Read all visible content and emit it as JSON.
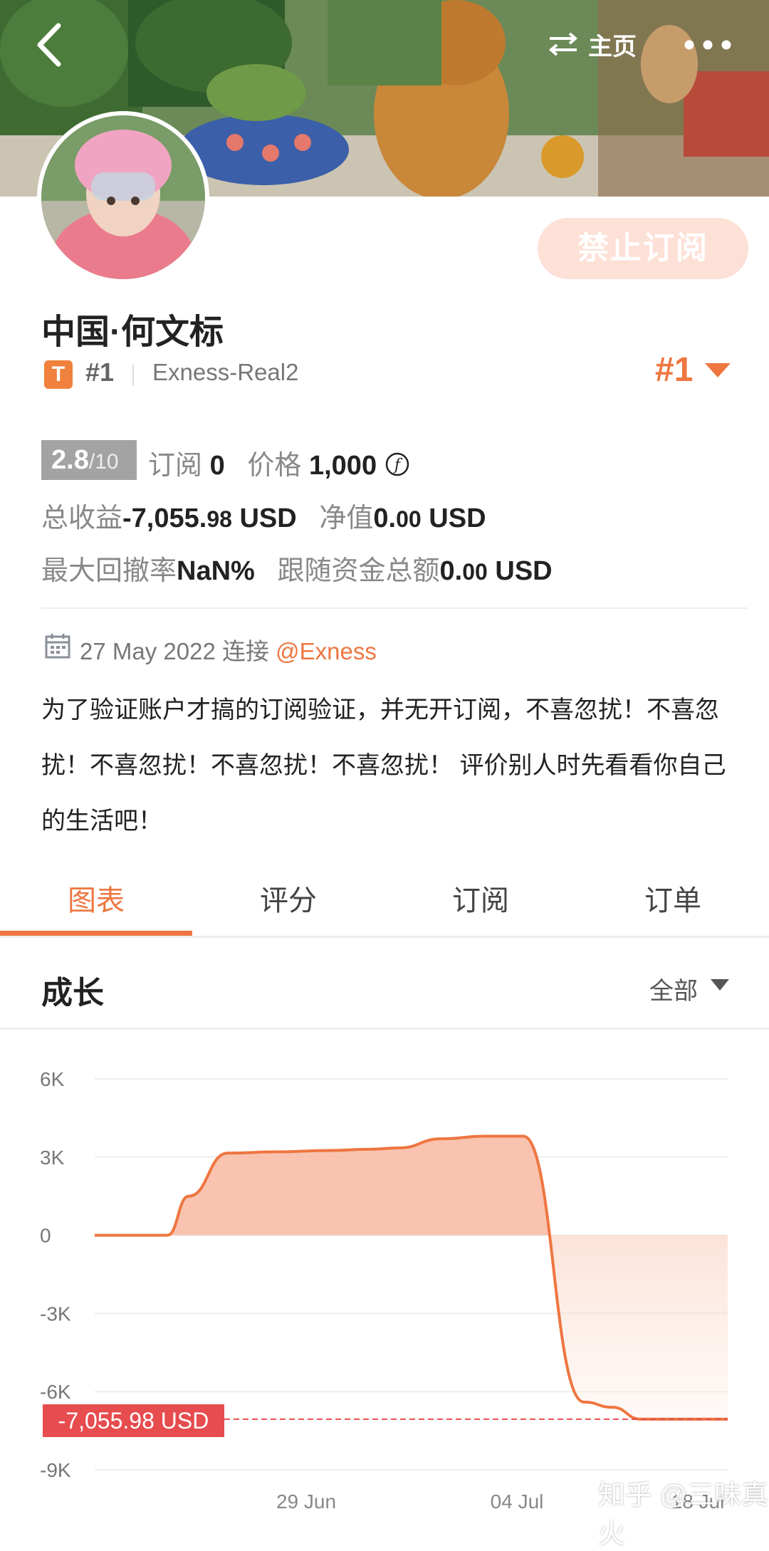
{
  "header": {
    "back_icon": "chevron-left-icon",
    "switch_icon": "swap-arrows-icon",
    "home_label": "主页",
    "more_icon": "more-dots-icon"
  },
  "profile": {
    "subscribe_button": "禁止订阅",
    "name": "中国·何文标",
    "tier_badge": "T",
    "rank_small": "#1",
    "server": "Exness-Real2",
    "rank_big": "#1"
  },
  "stats": {
    "score": "2.8",
    "score_max": "/10",
    "subscribe_label": "订阅",
    "subscribe_count": "0",
    "price_label": "价格",
    "price_value": "1,000",
    "total_profit_label": "总收益",
    "total_profit_int": "-7,055.",
    "total_profit_dec": "98",
    "total_profit_unit": " USD",
    "equity_label": "净值",
    "equity_int": "0.",
    "equity_dec": "00",
    "equity_unit": " USD",
    "drawdown_label": "最大回撤率",
    "drawdown_value": "NaN%",
    "follow_label": "跟随资金总额",
    "follow_int": "0.",
    "follow_dec": "00",
    "follow_unit": " USD"
  },
  "connection": {
    "date": "27 May 2022",
    "connect_label": "连接",
    "broker_link": "@Exness"
  },
  "bio": "为了验证账户才搞的订阅验证，并无开订阅，不喜忽扰！不喜忽扰！不喜忽扰！不喜忽扰！不喜忽扰！ 评价别人时先看看你自己的生活吧！",
  "tabs": [
    "图表",
    "评分",
    "订阅",
    "订单"
  ],
  "active_tab": 0,
  "section": {
    "title": "成长",
    "filter": "全部"
  },
  "colors": {
    "accent": "#ee7640",
    "negative_tag": "#e74c4f"
  },
  "chart_data": {
    "type": "area",
    "y_ticks": [
      "6K",
      "3K",
      "0",
      "-3K",
      "-6K",
      "-9K"
    ],
    "ylim": [
      -9000,
      6000
    ],
    "x_labels": [
      "29 Jun",
      "04 Jul",
      "18 Jul"
    ],
    "series": [
      {
        "values": [
          0,
          0,
          1500,
          3150,
          3200,
          3250,
          3300,
          3350,
          3700,
          3800,
          3800,
          -6400,
          -6600,
          -7055.98,
          -7055.98
        ]
      }
    ],
    "final_value_label": "-7,055.98 USD",
    "final_value": -7055.98,
    "grid": true
  },
  "watermark": "知乎 @三味真火"
}
